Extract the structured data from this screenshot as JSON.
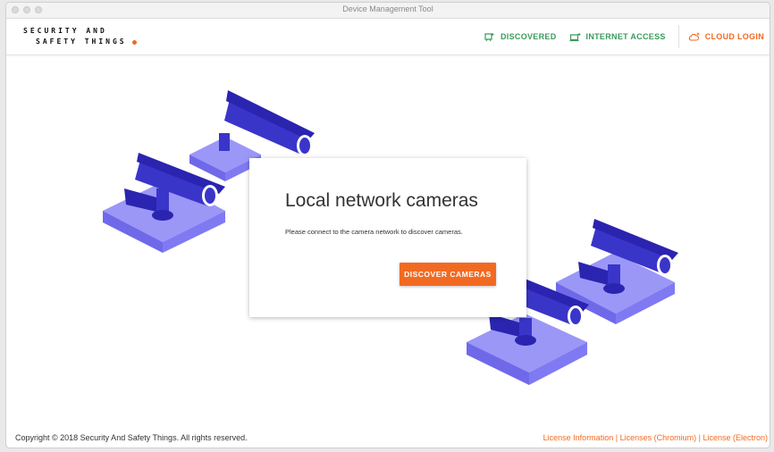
{
  "window": {
    "title": "Device Management Tool"
  },
  "header": {
    "logo_line1": "SECURITY AND",
    "logo_line2": "SAFETY THINGS",
    "nav": [
      {
        "label": "DISCOVERED",
        "icon": "discovered-icon"
      },
      {
        "label": "INTERNET ACCESS",
        "icon": "internet-access-icon"
      },
      {
        "label": "CLOUD LOGIN",
        "icon": "cloud-icon"
      }
    ]
  },
  "card": {
    "title": "Local network cameras",
    "message": "Please connect to the camera network to discover cameras.",
    "button": "DISCOVER CAMERAS"
  },
  "footer": {
    "copyright": "Copyright © 2018 Security And Safety Things. All rights reserved.",
    "links": [
      "License Information",
      "Licenses (Chromium)",
      "License (Electron)"
    ],
    "separator": "|"
  },
  "colors": {
    "accent": "#f26a21",
    "green": "#3b9a5c",
    "camera_dark": "#3a35c9",
    "camera_light": "#8b86f5"
  }
}
